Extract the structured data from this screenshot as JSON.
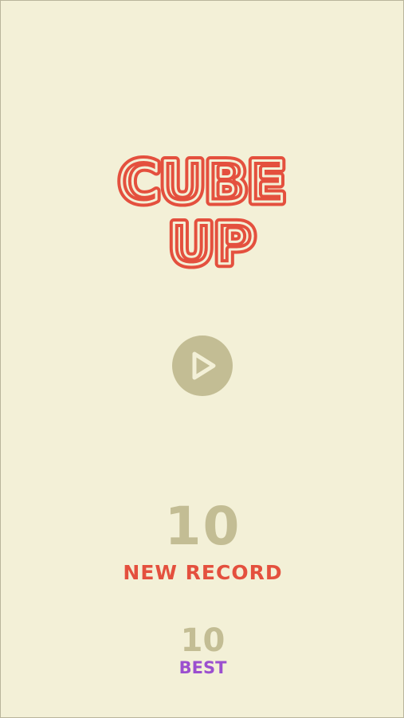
{
  "title": {
    "line1": "CUBE",
    "line2": "UP"
  },
  "play_button": {
    "icon": "play-icon"
  },
  "score": {
    "current": "10",
    "status": "NEW RECORD",
    "best": "10",
    "best_label": "BEST"
  },
  "colors": {
    "background": "#f3f0d7",
    "title": "#e4503e",
    "muted": "#c3bd94",
    "best_label": "#9b4fcf"
  }
}
